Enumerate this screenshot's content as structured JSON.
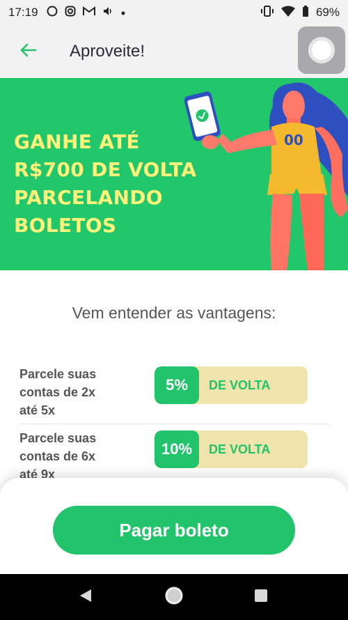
{
  "status_bar": {
    "time": "17:19",
    "battery": "69%"
  },
  "header": {
    "title": "Aproveite!"
  },
  "banner": {
    "headline_lines": [
      "GANHE ATÉ",
      "R$700 DE VOLTA",
      "PARCELANDO",
      "BOLETOS"
    ],
    "jersey_number": "00"
  },
  "intro": "Vem entender as vantagens:",
  "benefits": [
    {
      "description": [
        "Parcele suas",
        "contas de 2x",
        "até 5x"
      ],
      "percent": "5%",
      "label": "DE VOLTA"
    },
    {
      "description": [
        "Parcele suas",
        "contas de 6x",
        "até 9x"
      ],
      "percent": "10%",
      "label": "DE VOLTA"
    }
  ],
  "cta": {
    "label": "Pagar boleto"
  },
  "colors": {
    "brand_green": "#21c46b",
    "banner_green": "#22c76b",
    "headline_yellow": "#fff37a",
    "pill_cream": "#f0e4ad"
  }
}
